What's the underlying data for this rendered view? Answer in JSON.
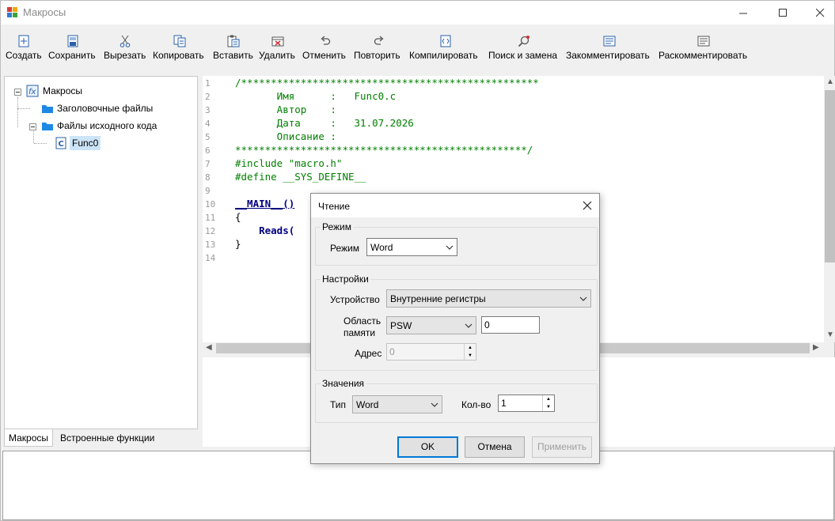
{
  "window": {
    "title": "Макросы"
  },
  "toolbar": [
    {
      "id": "create",
      "label": "Создать",
      "icon": "new-file-icon"
    },
    {
      "id": "save",
      "label": "Сохранить",
      "icon": "save-icon"
    },
    {
      "id": "cut",
      "label": "Вырезать",
      "icon": "scissors-icon"
    },
    {
      "id": "copy",
      "label": "Копировать",
      "icon": "copy-icon"
    },
    {
      "id": "paste",
      "label": "Вставить",
      "icon": "paste-icon"
    },
    {
      "id": "delete",
      "label": "Удалить",
      "icon": "delete-icon"
    },
    {
      "id": "undo",
      "label": "Отменить",
      "icon": "undo-icon"
    },
    {
      "id": "redo",
      "label": "Повторить",
      "icon": "redo-icon"
    },
    {
      "id": "compile",
      "label": "Компилировать",
      "icon": "compile-icon"
    },
    {
      "id": "find",
      "label": "Поиск и замена",
      "icon": "find-replace-icon"
    },
    {
      "id": "comment",
      "label": "Закомментировать",
      "icon": "comment-icon"
    },
    {
      "id": "uncomment",
      "label": "Раскомментировать",
      "icon": "uncomment-icon"
    }
  ],
  "tree": {
    "root": "Макросы",
    "headers": "Заголовочные файлы",
    "sources": "Файлы исходного кода",
    "func": "Func0"
  },
  "tabs": {
    "macros": "Макросы",
    "builtin": "Встроенные функции"
  },
  "editor": {
    "line_numbers": [
      "1",
      "2",
      "3",
      "4",
      "5",
      "6",
      "7",
      "8",
      "9",
      "10",
      "11",
      "12",
      "13",
      "14"
    ],
    "lines": [
      "/**************************************************",
      "       Имя      :   Func0.c",
      "       Автор    :",
      "       Дата     :   31.07.2026",
      "       Описание :",
      "*************************************************/",
      "#include \"macro.h\"",
      "#define __SYS_DEFINE__",
      "",
      "__MAIN__()",
      "{",
      "    Reads(",
      "}",
      ""
    ]
  },
  "dialog": {
    "title": "Чтение",
    "mode_group": "Режим",
    "mode_label": "Режим",
    "mode_value": "Word",
    "settings_group": "Настройки",
    "device_label": "Устройство",
    "device_value": "Внутренние регистры",
    "area_label_1": "Область",
    "area_label_2": "памяти",
    "area_value": "PSW",
    "area_offset": "0",
    "address_label": "Адрес",
    "address_value": "0",
    "values_group": "Значения",
    "type_label": "Тип",
    "type_value": "Word",
    "count_label": "Кол-во",
    "count_value": "1",
    "ok": "OK",
    "cancel": "Отмена",
    "apply": "Применить"
  }
}
